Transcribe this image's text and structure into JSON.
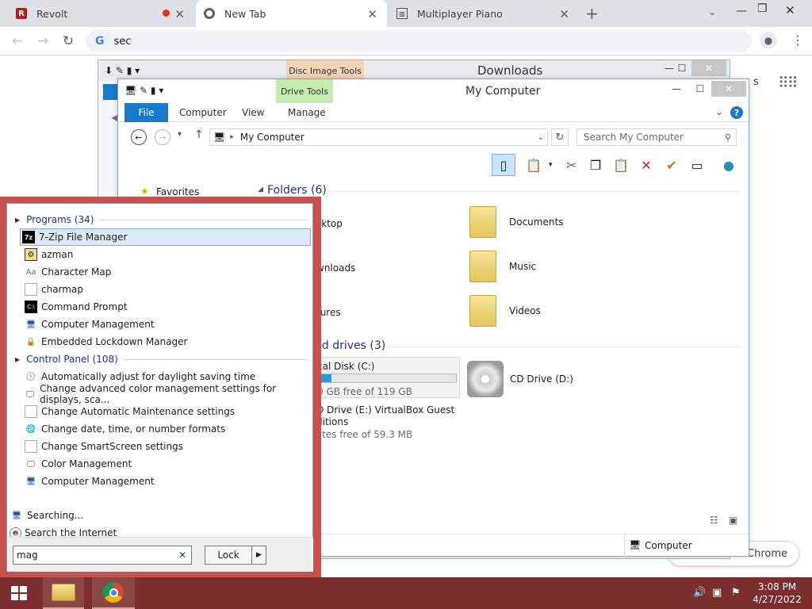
{
  "browser": {
    "tabs": [
      {
        "title": "Revolt"
      },
      {
        "title": "New Tab"
      },
      {
        "title": "Multiplayer Piano"
      }
    ],
    "address": "sec",
    "toast": "Chrome"
  },
  "downloads_window": {
    "title": "Downloads",
    "context_tab": "Disc Image Tools",
    "side_glyph": "s"
  },
  "computer_window": {
    "title": "My Computer",
    "context_tab": "Drive Tools",
    "ribbon_tabs": [
      "File",
      "Computer",
      "View",
      "Manage"
    ],
    "address_path": "My Computer",
    "search_placeholder": "Search My Computer",
    "favorites_label": "Favorites",
    "folders_header": "Folders (6)",
    "folders": [
      "sktop",
      "Documents",
      "wnloads",
      "Music",
      "tures",
      "Videos"
    ],
    "drives_header": "nd drives (3)",
    "drive_c_name": "cal Disk (C:)",
    "drive_c_free": "0 GB free of 119 GB",
    "drive_c_used_fraction": 0.1,
    "drive_d_name": "CD Drive (D:)",
    "drive_e_name_line1": "D Drive (E:) VirtualBox Guest",
    "drive_e_name_line2": "ditions",
    "drive_e_free": "ytes free of 59.3 MB",
    "status_computer": "Computer"
  },
  "start_menu": {
    "programs_header": "Programs (34)",
    "programs": [
      "7-Zip File Manager",
      "azman",
      "Character Map",
      "charmap",
      "Command Prompt",
      "Computer Management",
      "Embedded Lockdown Manager"
    ],
    "control_panel_header": "Control Panel (108)",
    "control_panel": [
      "Automatically adjust for daylight saving time",
      "Change advanced color management settings for displays, sca...",
      "Change Automatic Maintenance settings",
      "Change date, time, or number formats",
      "Change SmartScreen settings",
      "Color Management",
      "Computer Management"
    ],
    "searching": "Searching...",
    "search_internet": "Search the Internet",
    "search_value": "mag",
    "lock_label": "Lock"
  },
  "taskbar": {
    "time": "3:08 PM",
    "date": "4/27/2022"
  },
  "colors": {
    "accent_blue": "#1979ca",
    "start_menu_frame": "#c9504f",
    "taskbar": "#7a2e2d"
  }
}
